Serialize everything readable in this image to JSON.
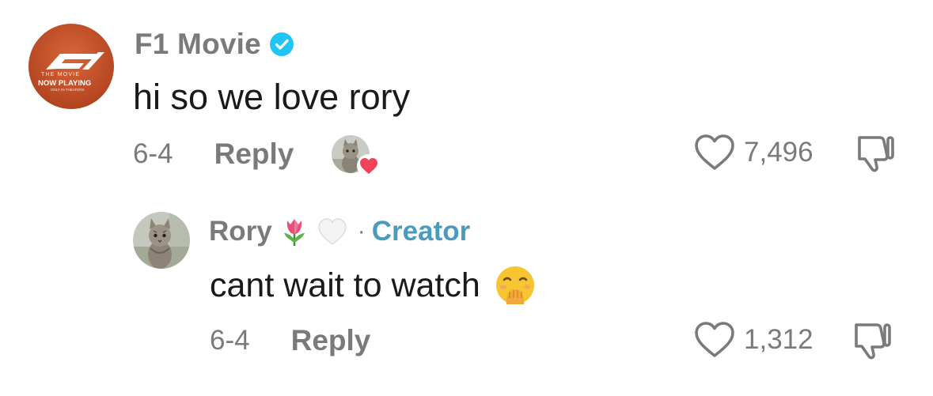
{
  "comment": {
    "username": "F1 Movie",
    "verified": true,
    "avatar_text": {
      "line1": "THE MOVIE",
      "line2": "NOW PLAYING",
      "line3": "ONLY IN THEATERS"
    },
    "text": "hi so we love rory",
    "date": "6-4",
    "reply_label": "Reply",
    "likes": "7,496",
    "creator_liked": true
  },
  "reply": {
    "username": "Rory",
    "name_emojis": [
      "tulip-emoji",
      "white-heart-emoji"
    ],
    "separator": "·",
    "badge": "Creator",
    "text": "cant wait to watch",
    "text_emoji": "face-with-hand-over-mouth-emoji",
    "date": "6-4",
    "reply_label": "Reply",
    "likes": "1,312"
  },
  "colors": {
    "muted_text": "#7a7a7a",
    "creator_badge": "#4a9bbd",
    "verified_badge": "#20c5f5",
    "liked_heart": "#f0435a",
    "f1_avatar_bg": "#c4522a"
  }
}
